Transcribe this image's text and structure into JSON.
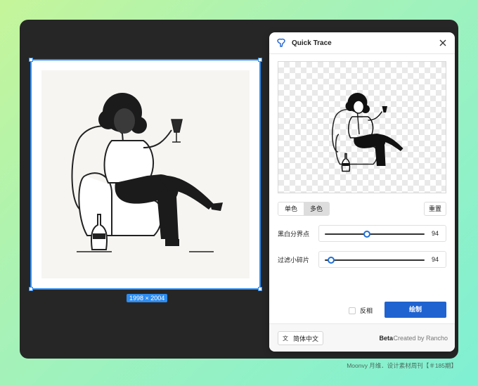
{
  "canvas": {
    "dimensions_label": "1998 × 2004"
  },
  "panel": {
    "title": "Quick Trace",
    "mode_tabs": [
      {
        "label": "单色",
        "active": false
      },
      {
        "label": "多色",
        "active": true
      }
    ],
    "reset_label": "重置",
    "threshold": {
      "label": "黑白分界点",
      "value": "94",
      "fraction": 0.42
    },
    "filter": {
      "label": "过滤小碎片",
      "value": "94",
      "fraction": 0.06
    },
    "invert_label": "反相",
    "draw_label": "绘制",
    "language_label": "简体中文",
    "beta_label": "Beta",
    "credit": "Created by Rancho"
  },
  "footnote": "Moonvy 月维．设计素材周刊【＃185期】",
  "colors": {
    "accent": "#1f63d0",
    "selection": "#2d8cf0",
    "window_bg": "#262626"
  }
}
